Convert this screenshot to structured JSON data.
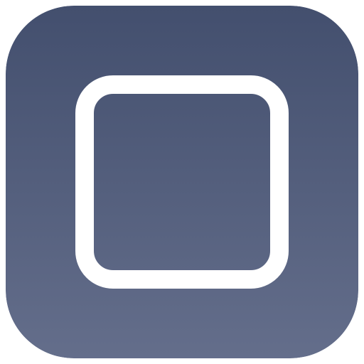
{
  "icon": {
    "name": "rounded-square-app-icon",
    "glyph": "rounded-square-outline",
    "colors": {
      "gradient_top": "#434F6E",
      "gradient_bottom": "#646E8B",
      "glyph_stroke": "#FFFFFF"
    }
  }
}
